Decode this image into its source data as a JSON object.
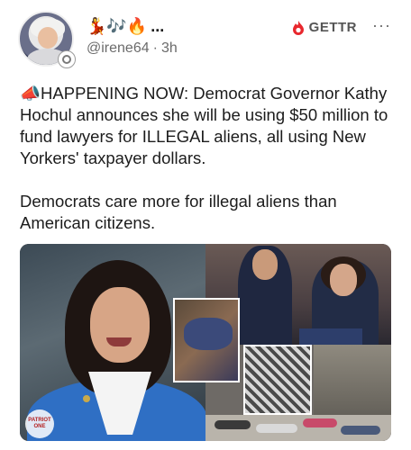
{
  "author": {
    "display_name_emojis": "💃🎶🔥",
    "ellipsis": "...",
    "handle": "@irene64",
    "separator": "·",
    "time_ago": "3h"
  },
  "platform": {
    "name": "GETTR",
    "brand_color": "#e8272d"
  },
  "menu": {
    "more_label": "···"
  },
  "post": {
    "paragraph_1": "📣HAPPENING NOW: Democrat Governor Kathy Hochul announces she will be using $50 million to fund lawyers for ILLEGAL aliens, all using New Yorkers' taxpayer dollars.",
    "paragraph_2": "Democrats care more for illegal aliens than American citizens."
  },
  "media": {
    "watermark_text": "PATRIOT ONE"
  }
}
